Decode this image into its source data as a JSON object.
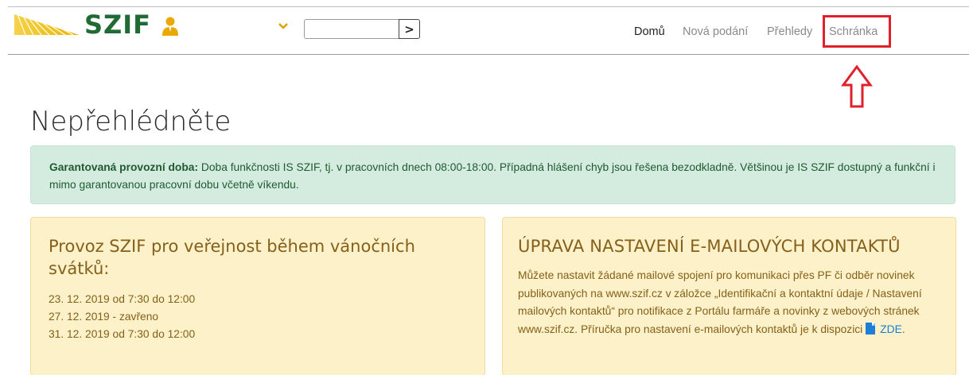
{
  "header": {
    "logo_text": "SZIF",
    "nav": {
      "home": "Domů",
      "new_submissions": "Nová podání",
      "overviews": "Přehledy",
      "inbox": "Schránka"
    },
    "select_value": "",
    "go_button": ">"
  },
  "page": {
    "title": "Nepřehlédněte"
  },
  "alert": {
    "label": "Garantovaná provozní doba:",
    "text": " Doba funkčnosti IS SZIF, tj. v pracovních dnech 08:00-18:00. Případná hlášení chyb jsou řešena bezodkladně. Většinou je IS SZIF dostupný a funkční i mimo garantovanou pracovní dobu včetně víkendu."
  },
  "cards": {
    "holidays": {
      "title": "Provoz SZIF pro veřejnost během vánočních svátků:",
      "dates": [
        "23. 12. 2019 od 7:30 do 12:00",
        "27. 12. 2019 - zavřeno",
        "31. 12. 2019 od 7:30 do 12:00"
      ]
    },
    "email": {
      "title": "ÚPRAVA NASTAVENÍ E-MAILOVÝCH KONTAKTŮ",
      "text": "Můžete nastavit žádané mailové spojení pro komunikaci přes PF či odběr novinek publikovaných na www.szif.cz v záložce „Identifikační a kontaktní údaje / Nastavení mailových kontaktů“ pro notifikace z Portálu farmáře a novinky z webových stránek www.szif.cz. Příručka pro nastavení e-mailových kontaktů je k dispozici",
      "link": "ZDE",
      "link_suffix": "."
    }
  },
  "colors": {
    "brand_green": "#1f6b33",
    "logo_yellow": "#f5c200",
    "highlight_red": "#e0202a",
    "alert_bg": "#d4ecdf",
    "card_bg": "#fcf1c9"
  },
  "icons": {
    "user": "user-icon",
    "dropdown": "chevron-down-icon",
    "arrow": "up-arrow-annotation",
    "pdf": "pdf-icon"
  }
}
